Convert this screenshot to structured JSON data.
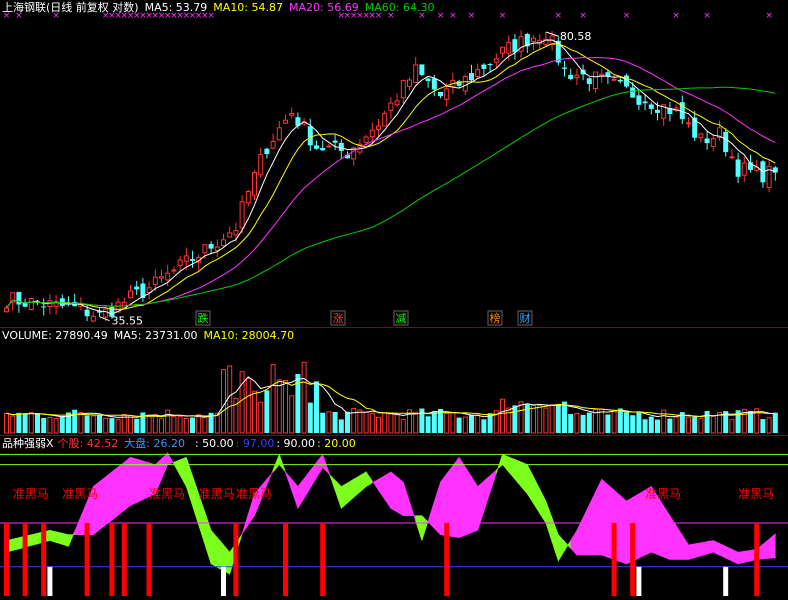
{
  "colors": {
    "background": "#000000",
    "up": "#ff3333",
    "down": "#54ffff",
    "ma5": "#ffffff",
    "ma10": "#ffff00",
    "ma20": "#ff33ff",
    "ma60": "#00cc00",
    "white": "#ffffff",
    "magenta": "#ff33ff",
    "green": "#7cff1c",
    "red": "#ff0000",
    "blue": "#3344ff",
    "separator": "#8b0000"
  },
  "price_panel": {
    "title": "上海钢联(日线 前复权 对数)",
    "ma5_label": "MA5: 53.79",
    "ma10_label": "MA10: 54.87",
    "ma20_label": "MA20: 56.69",
    "ma60_label": "MA60: 64.30",
    "high_label": "80.58",
    "low_label": "35.55",
    "events": [
      {
        "label": "跌",
        "color": "#00ff00"
      },
      {
        "label": "涨",
        "color": "#ff3333"
      },
      {
        "label": "减",
        "color": "#00ff00"
      },
      {
        "label": "榜",
        "color": "#ff8800"
      },
      {
        "label": "财",
        "color": "#33aaff"
      }
    ]
  },
  "volume_panel": {
    "volume_label": "VOLUME: 27890.49",
    "ma5_label": "MA5: 23731.00",
    "ma10_label": "MA10: 28004.70"
  },
  "indicator_panel": {
    "name": "品种强弱X",
    "stock_label": "个股: 42.52",
    "market_label": "大盘: 26.20",
    "l50": ": 50.00",
    "l97": ": 97.00",
    "l90": ": 90.00",
    "l20": ": 20.00",
    "marker_text": "准黑马"
  },
  "chart_data": {
    "type": "candlestick",
    "scale": "log",
    "bars": 125,
    "close_keypoints": [
      [
        0,
        37.4
      ],
      [
        12,
        36.3
      ],
      [
        15,
        35.6
      ],
      [
        24,
        39
      ],
      [
        32,
        43
      ],
      [
        37,
        46
      ],
      [
        42,
        58
      ],
      [
        46,
        64
      ],
      [
        50,
        58
      ],
      [
        55,
        57
      ],
      [
        60,
        62
      ],
      [
        66,
        72
      ],
      [
        70,
        67
      ],
      [
        75,
        71
      ],
      [
        80,
        76
      ],
      [
        84,
        79
      ],
      [
        87,
        80.6
      ],
      [
        90,
        72
      ],
      [
        96,
        70
      ],
      [
        102,
        67
      ],
      [
        108,
        64
      ],
      [
        112,
        59
      ],
      [
        115,
        60
      ],
      [
        118,
        54.5
      ],
      [
        121,
        53.5
      ],
      [
        124,
        53.8
      ]
    ],
    "ma5_last": 53.79,
    "ma10_last": 54.87,
    "ma20_last": 56.69,
    "ma60_last": 64.3,
    "price_high": 80.58,
    "price_low": 35.55,
    "volume_last": 27890.49,
    "volume_ma5": 23731.0,
    "volume_ma10": 28004.7,
    "indicator": {
      "stock_last": 42.52,
      "market_last": 26.2,
      "levels": [
        20,
        50,
        90,
        97
      ],
      "stock_keypoints": [
        [
          0,
          30
        ],
        [
          7,
          38
        ],
        [
          10,
          34
        ],
        [
          14,
          75
        ],
        [
          20,
          95
        ],
        [
          24,
          90
        ],
        [
          26,
          98
        ],
        [
          29,
          75
        ],
        [
          33,
          22
        ],
        [
          36,
          15
        ],
        [
          40,
          70
        ],
        [
          44,
          90
        ],
        [
          47,
          75
        ],
        [
          51,
          97
        ],
        [
          54,
          60
        ],
        [
          58,
          75
        ],
        [
          62,
          85
        ],
        [
          64,
          78
        ],
        [
          67,
          38
        ],
        [
          70,
          78
        ],
        [
          73,
          95
        ],
        [
          76,
          75
        ],
        [
          80,
          90
        ],
        [
          84,
          70
        ],
        [
          87,
          50
        ],
        [
          89,
          24
        ],
        [
          92,
          45
        ],
        [
          96,
          80
        ],
        [
          100,
          65
        ],
        [
          104,
          75
        ],
        [
          107,
          55
        ],
        [
          110,
          35
        ],
        [
          114,
          38
        ],
        [
          118,
          30
        ],
        [
          121,
          32
        ],
        [
          124,
          42.5
        ]
      ],
      "market_keypoints": [
        [
          0,
          38
        ],
        [
          7,
          45
        ],
        [
          10,
          42
        ],
        [
          14,
          42
        ],
        [
          20,
          62
        ],
        [
          24,
          70
        ],
        [
          26,
          90
        ],
        [
          29,
          95
        ],
        [
          33,
          45
        ],
        [
          36,
          30
        ],
        [
          40,
          55
        ],
        [
          44,
          97
        ],
        [
          47,
          60
        ],
        [
          51,
          88
        ],
        [
          54,
          75
        ],
        [
          58,
          85
        ],
        [
          62,
          60
        ],
        [
          64,
          55
        ],
        [
          67,
          55
        ],
        [
          70,
          42
        ],
        [
          73,
          40
        ],
        [
          76,
          45
        ],
        [
          80,
          97
        ],
        [
          84,
          90
        ],
        [
          87,
          65
        ],
        [
          89,
          42
        ],
        [
          92,
          28
        ],
        [
          96,
          28
        ],
        [
          100,
          22
        ],
        [
          104,
          30
        ],
        [
          107,
          25
        ],
        [
          110,
          25
        ],
        [
          114,
          30
        ],
        [
          118,
          22
        ],
        [
          121,
          25
        ],
        [
          124,
          26.2
        ]
      ],
      "marker_bars": [
        1,
        9,
        23,
        31,
        37,
        103,
        118
      ],
      "marker_rows": [
        0,
        0,
        0,
        0,
        0,
        0,
        0
      ],
      "white_bars": [
        7,
        35,
        102,
        116
      ],
      "red_bars": [
        0,
        3,
        6,
        13,
        17,
        19,
        23,
        37,
        45,
        51,
        71,
        98,
        101,
        121
      ]
    }
  }
}
